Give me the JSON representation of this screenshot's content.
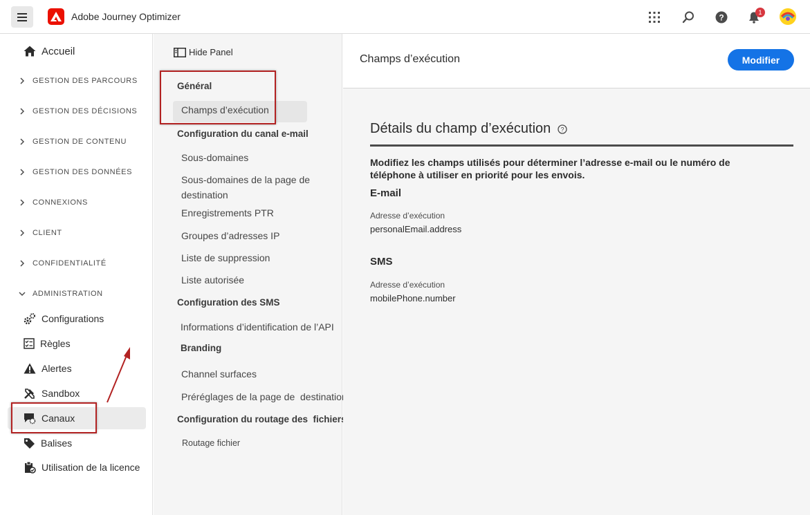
{
  "header": {
    "app_title": "Adobe Journey Optimizer",
    "notification_count": "1",
    "icons": [
      "menu-icon",
      "adobe-logo",
      "apps-grid-icon",
      "search-icon",
      "help-icon",
      "bell-icon",
      "avatar"
    ]
  },
  "leftnav": {
    "home_label": "Accueil",
    "sections": [
      "GESTION DES PARCOURS",
      "GESTION DES DÉCISIONS",
      "GESTION DE CONTENU",
      "GESTION DES DONNÉES",
      "CONNEXIONS",
      "CLIENT",
      "CONFIDENTIALITÉ",
      "ADMINISTRATION"
    ],
    "admin_items": [
      "Configurations",
      "Règles",
      "Alertes",
      "Sandbox",
      "Canaux",
      "Balises",
      "Utilisation de la licence"
    ],
    "active_item": "Canaux"
  },
  "midpanel": {
    "hide_panel": "Hide Panel",
    "general_head": "Général",
    "general_items": [
      "Champs d’exécution"
    ],
    "email_head": "Configuration du canal e-mail",
    "email_items": [
      "Sous-domaines",
      "Sous-domaines de la page de destination",
      "Enregistrements PTR",
      "Groupes d’adresses IP",
      "Liste de suppression",
      "Liste autorisée"
    ],
    "sms_head": "Configuration des SMS",
    "sms_items": [
      "Informations d’identification de l’API"
    ],
    "branding_head": "Branding",
    "branding_items": [
      "Channel surfaces",
      "Préréglages de la page de  destination"
    ],
    "routing_head": "Configuration du routage des  fichiers",
    "routing_items": [
      "Routage fichier"
    ]
  },
  "main": {
    "title": "Champs d’exécution",
    "modify_button": "Modifier",
    "details_title": "Détails du champ d’exécution",
    "description": "Modifiez les champs utilisés pour déterminer l’adresse e-mail ou le numéro de téléphone à utiliser en priorité pour les envois.",
    "email": {
      "title": "E-mail",
      "label": "Adresse d’exécution",
      "value": "personalEmail.address"
    },
    "sms": {
      "title": "SMS",
      "label": "Adresse d’exécution",
      "value": "mobilePhone.number"
    }
  },
  "colors": {
    "accent": "#1473e6",
    "adobe_red": "#eb1000",
    "annotation_red": "#b22222"
  }
}
